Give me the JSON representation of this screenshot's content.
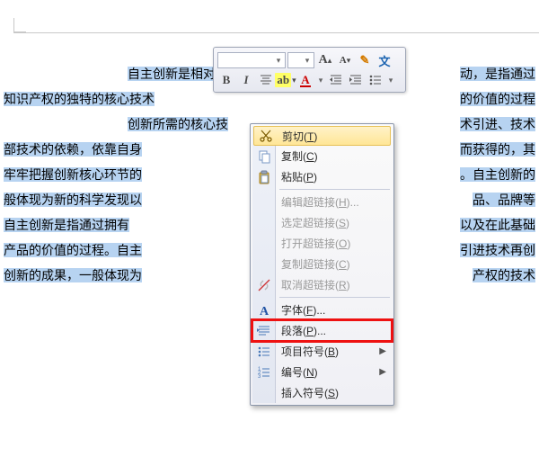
{
  "document": {
    "lines": [
      {
        "pre": "",
        "sel": "自主创新是相对于技",
        "gap": "",
        "post": "动，是指通过"
      },
      {
        "pre": "",
        "sel": "知识产权的独特的核心技术",
        "gap": "",
        "post": "的价值的过程"
      },
      {
        "pre": "",
        "sel": "创新所需的核心技",
        "gap": "",
        "post": "术引进、技术"
      },
      {
        "pre": "",
        "sel": "部技术的依赖，依靠自身",
        "gap": "",
        "post": "而获得的，其"
      },
      {
        "pre": "",
        "sel": "牢牢把握创新核心环节的",
        "gap": "",
        "post": "。自主创新的"
      },
      {
        "pre": "",
        "sel": "般体现为新的科学发现以",
        "gap": "",
        "post": "品、品牌等"
      },
      {
        "pre": "",
        "sel": "自主创新是指通过拥有",
        "gap": "",
        "post": "以及在此基础"
      },
      {
        "pre": "",
        "sel": "产品的价值的过程。自主",
        "gap": "",
        "post": "引进技术再创"
      },
      {
        "pre": "",
        "sel": "创新的成果，一般体现为",
        "gap": "",
        "post": "产权的技术"
      }
    ]
  },
  "mini_toolbar": {
    "font_name": "",
    "font_size": "",
    "grow": "A",
    "shrink": "A",
    "brush": "✎",
    "bold": "B",
    "italic": "I",
    "center": "≡",
    "highlight": "ab",
    "fontcolor": "A",
    "indent_dec": "≡",
    "indent_inc": "≡",
    "bullets": "≡"
  },
  "context_menu": {
    "items": [
      {
        "key": "cut",
        "label": "剪切(",
        "hot": "T",
        "tail": ")",
        "enabled": true,
        "selected": true,
        "icon": "scissors"
      },
      {
        "key": "copy",
        "label": "复制(",
        "hot": "C",
        "tail": ")",
        "enabled": true,
        "icon": "copy"
      },
      {
        "key": "paste",
        "label": "粘贴(",
        "hot": "P",
        "tail": ")",
        "enabled": true,
        "icon": "paste"
      },
      {
        "sep": true
      },
      {
        "key": "edit-hyper",
        "label": "编辑超链接(",
        "hot": "H",
        "tail": ")...",
        "enabled": false
      },
      {
        "key": "select-hyper",
        "label": "选定超链接(",
        "hot": "S",
        "tail": ")",
        "enabled": false
      },
      {
        "key": "open-hyper",
        "label": "打开超链接(",
        "hot": "O",
        "tail": ")",
        "enabled": false
      },
      {
        "key": "copy-hyper",
        "label": "复制超链接(",
        "hot": "C",
        "tail": ")",
        "enabled": false
      },
      {
        "key": "remove-hyper",
        "label": "取消超链接(",
        "hot": "R",
        "tail": ")",
        "enabled": false,
        "icon": "unlink"
      },
      {
        "sep": true
      },
      {
        "key": "font",
        "label": "字体(",
        "hot": "F",
        "tail": ")...",
        "enabled": true,
        "icon": "fontA"
      },
      {
        "key": "paragraph",
        "label": "段落(",
        "hot": "P",
        "tail": ")...",
        "enabled": true,
        "icon": "para",
        "highlight": true
      },
      {
        "key": "bullets",
        "label": "项目符号(",
        "hot": "B",
        "tail": ")",
        "enabled": true,
        "icon": "list",
        "submenu": true
      },
      {
        "key": "numbering",
        "label": "编号(",
        "hot": "N",
        "tail": ")",
        "enabled": true,
        "icon": "numlist",
        "submenu": true
      },
      {
        "key": "symbol",
        "label": "插入符号(",
        "hot": "S",
        "tail": ")",
        "enabled": true
      }
    ]
  }
}
